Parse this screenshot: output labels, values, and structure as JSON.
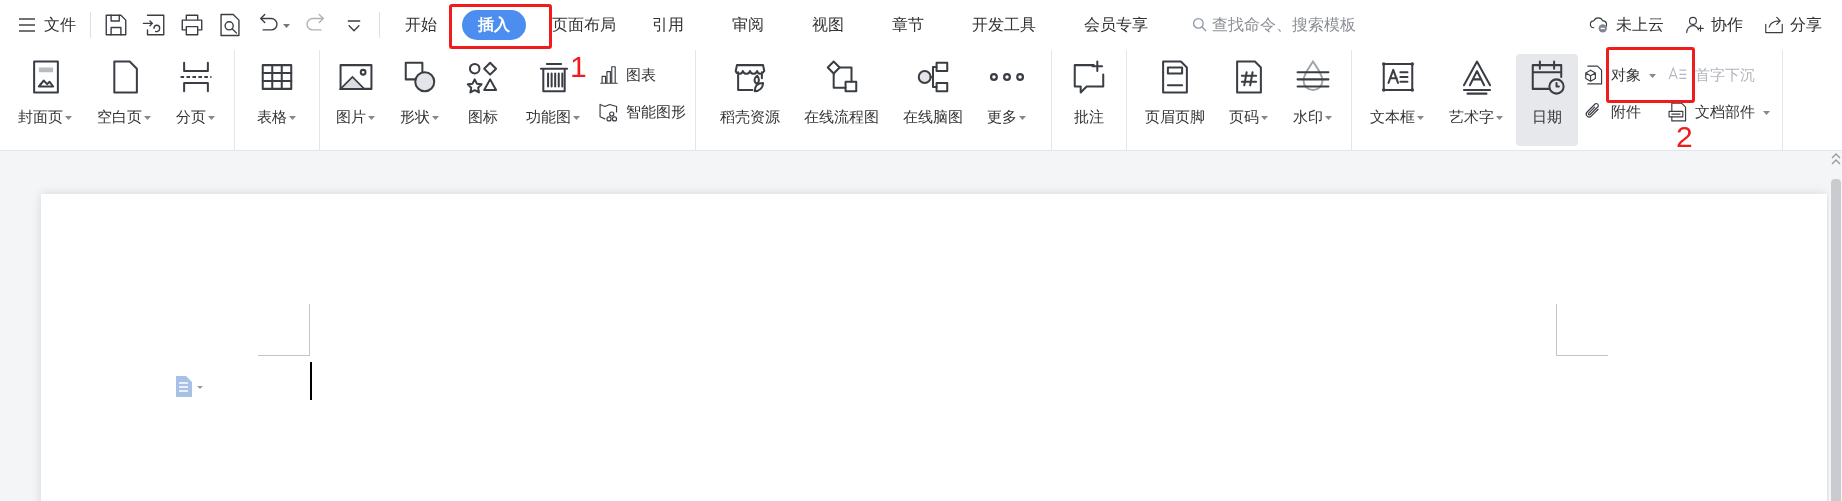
{
  "menu": {
    "label": "文件"
  },
  "quick_access": [
    {
      "disabled": false
    },
    {
      "disabled": false
    },
    {
      "disabled": false
    },
    {
      "disabled": false
    },
    {
      "disabled": false
    },
    {
      "disabled": true
    },
    {
      "disabled": false
    }
  ],
  "tabs": [
    {
      "label": "开始",
      "selected": false
    },
    {
      "label": "插入",
      "selected": true
    },
    {
      "label": "页面布局",
      "selected": false
    },
    {
      "label": "引用",
      "selected": false
    },
    {
      "label": "审阅",
      "selected": false
    },
    {
      "label": "视图",
      "selected": false
    },
    {
      "label": "章节",
      "selected": false
    },
    {
      "label": "开发工具",
      "selected": false
    },
    {
      "label": "会员专享",
      "selected": false
    }
  ],
  "search": {
    "placeholder": "查找命令、搜索模板"
  },
  "top_actions": [
    {
      "label": "未上云"
    },
    {
      "label": "协作"
    },
    {
      "label": "分享"
    }
  ],
  "ribbon": {
    "groups": [
      {
        "items": [
          {
            "kind": "large",
            "label": "封面页",
            "dropdown": true,
            "hovered": false
          },
          {
            "kind": "large",
            "label": "空白页",
            "dropdown": true,
            "hovered": false
          },
          {
            "kind": "large",
            "label": "分页",
            "dropdown": true,
            "hovered": false
          }
        ]
      },
      {
        "items": [
          {
            "kind": "large",
            "label": "表格",
            "dropdown": true,
            "hovered": false
          }
        ]
      },
      {
        "items": [
          {
            "kind": "large",
            "label": "图片",
            "dropdown": true,
            "hovered": false
          },
          {
            "kind": "large",
            "label": "形状",
            "dropdown": true,
            "hovered": false
          },
          {
            "kind": "large",
            "label": "图标",
            "dropdown": false,
            "hovered": false
          },
          {
            "kind": "large",
            "label": "功能图",
            "dropdown": true,
            "hovered": false
          },
          {
            "kind": "stack",
            "items": [
              {
                "label": "图表",
                "dropdown": false,
                "disabled": false
              },
              {
                "label": "智能图形",
                "dropdown": false,
                "disabled": false
              }
            ]
          }
        ]
      },
      {
        "items": [
          {
            "kind": "large",
            "label": "稻壳资源",
            "dropdown": false,
            "hovered": false
          },
          {
            "kind": "large",
            "label": "在线流程图",
            "dropdown": false,
            "hovered": false
          },
          {
            "kind": "large",
            "label": "在线脑图",
            "dropdown": false,
            "hovered": false
          },
          {
            "kind": "large",
            "label": "更多",
            "dropdown": true,
            "hovered": false
          }
        ]
      },
      {
        "items": [
          {
            "kind": "large",
            "label": "批注",
            "dropdown": false,
            "hovered": false
          }
        ]
      },
      {
        "items": [
          {
            "kind": "large",
            "label": "页眉页脚",
            "dropdown": false,
            "hovered": false
          },
          {
            "kind": "large",
            "label": "页码",
            "dropdown": true,
            "hovered": false
          },
          {
            "kind": "large",
            "label": "水印",
            "dropdown": true,
            "hovered": false
          }
        ]
      },
      {
        "items": [
          {
            "kind": "large",
            "label": "文本框",
            "dropdown": true,
            "hovered": false
          },
          {
            "kind": "large",
            "label": "艺术字",
            "dropdown": true,
            "hovered": false
          },
          {
            "kind": "large",
            "label": "日期",
            "dropdown": false,
            "hovered": true
          },
          {
            "kind": "stack",
            "items": [
              {
                "label": "对象",
                "dropdown": true,
                "disabled": false
              },
              {
                "label": "附件",
                "dropdown": false,
                "disabled": false
              }
            ]
          },
          {
            "kind": "stack",
            "items": [
              {
                "label": "首字下沉",
                "dropdown": false,
                "disabled": true
              },
              {
                "label": "文档部件",
                "dropdown": true,
                "disabled": false
              }
            ]
          }
        ]
      }
    ]
  },
  "annotations": [
    {
      "kind": "box"
    },
    {
      "kind": "number",
      "text": "1"
    },
    {
      "kind": "box"
    },
    {
      "kind": "number",
      "text": "2"
    }
  ]
}
